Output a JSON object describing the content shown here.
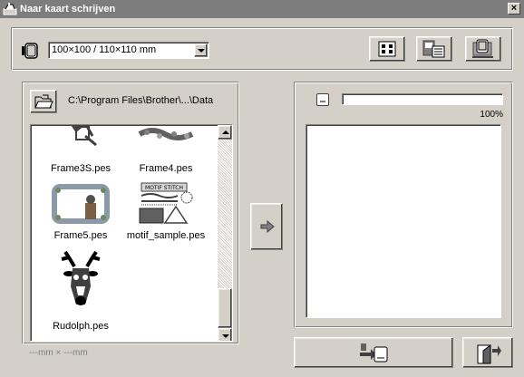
{
  "window": {
    "title": "Naar kaart schrijven",
    "close_glyph": "×",
    "titlebar_color": "#7d7d7d",
    "face_color": "#d4d0c8"
  },
  "top": {
    "card_icon": "card-icon",
    "size_select": {
      "selected": "100×100 / 110×110 mm"
    },
    "toolbar_icons": [
      "layout-grid-icon",
      "card-list-icon",
      "card-reader-icon"
    ]
  },
  "browser": {
    "folder_icon": "open-folder-icon",
    "path": "C:\\Program Files\\Brother\\...\\Data",
    "files": [
      {
        "name": "Frame3S.pes",
        "icon": "frame-design-icon"
      },
      {
        "name": "Frame4.pes",
        "icon": "frame-design-icon"
      },
      {
        "name": "Frame5.pes",
        "icon": "frame-design-icon"
      },
      {
        "name": "motif_sample.pes",
        "icon": "motif-design-icon"
      },
      {
        "name": "Rudolph.pes",
        "icon": "reindeer-design-icon"
      }
    ],
    "dimensions": "---mm × ---mm"
  },
  "transfer": {
    "icon": "right-arrow-icon"
  },
  "card": {
    "icon": "card-small-icon",
    "progress_percent": 100,
    "progress_label": "100%"
  },
  "actions": {
    "write_icon": "write-to-card-icon",
    "exit_icon": "exit-door-icon"
  }
}
